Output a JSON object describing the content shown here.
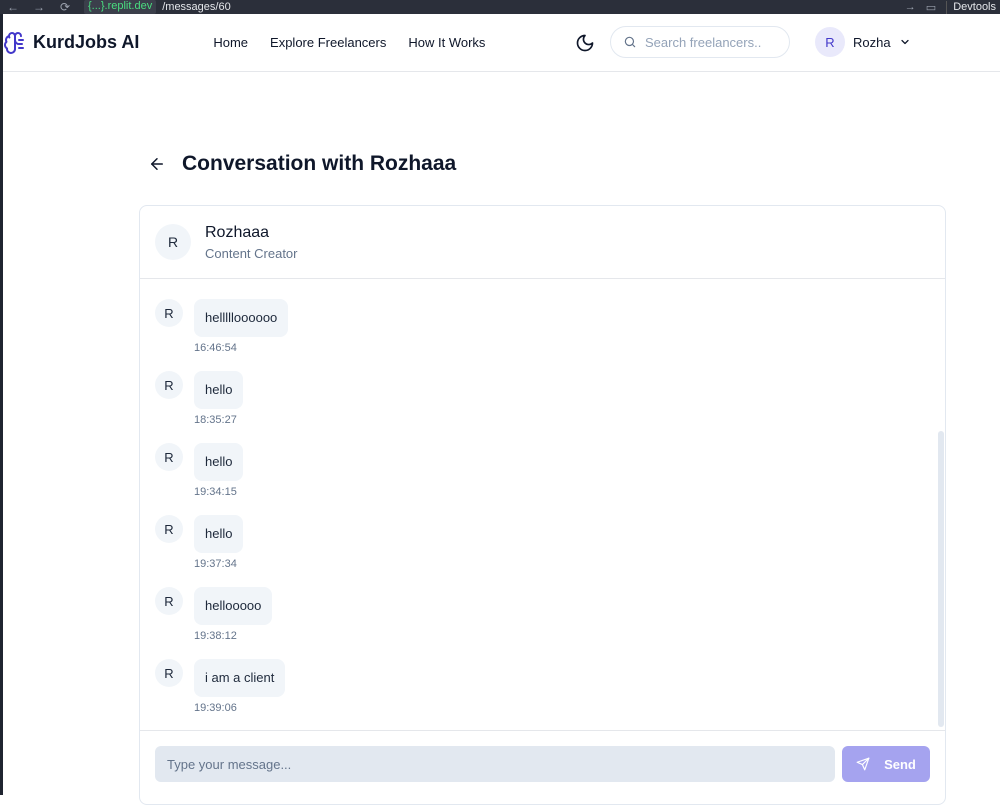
{
  "browser": {
    "url_host": "{...}.replit.dev",
    "url_path": "/messages/60",
    "devtools_label": "Devtools"
  },
  "header": {
    "brand": "KurdJobs AI",
    "nav": [
      "Home",
      "Explore Freelancers",
      "How It Works"
    ],
    "search_placeholder": "Search freelancers..",
    "user_initial": "R",
    "user_name": "Rozha"
  },
  "page": {
    "title": "Conversation with Rozhaaa"
  },
  "contact": {
    "initial": "R",
    "name": "Rozhaaa",
    "role": "Content Creator"
  },
  "messages": [
    {
      "initial": "R",
      "text": "hellllloooooo",
      "time": "16:46:54"
    },
    {
      "initial": "R",
      "text": "hello",
      "time": "18:35:27"
    },
    {
      "initial": "R",
      "text": "hello",
      "time": "19:34:15"
    },
    {
      "initial": "R",
      "text": "hello",
      "time": "19:37:34"
    },
    {
      "initial": "R",
      "text": "hellooooo",
      "time": "19:38:12"
    },
    {
      "initial": "R",
      "text": "i am a client",
      "time": "19:39:06"
    }
  ],
  "composer": {
    "placeholder": "Type your message...",
    "send_label": "Send"
  },
  "colors": {
    "accent": "#4338ca",
    "send_button": "#a5a3ef",
    "bubble": "#f1f5f9"
  }
}
